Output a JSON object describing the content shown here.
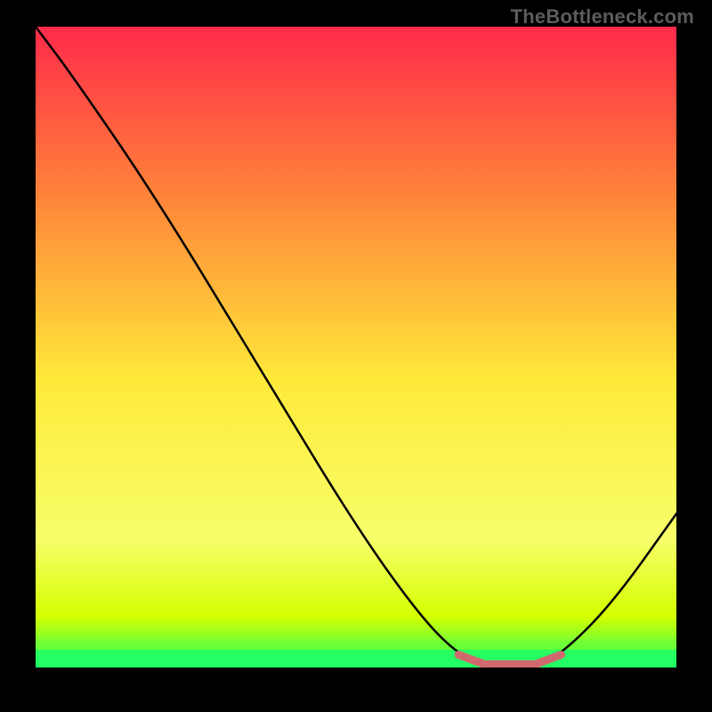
{
  "watermark": "TheBottleneck.com",
  "colors": {
    "background": "#000000",
    "gradient_top": "#ff2a4a",
    "gradient_mid_upper": "#ff7f3a",
    "gradient_mid": "#ffe93a",
    "gradient_mid_lower": "#f7ff6a",
    "gradient_band": "#d4ff00",
    "gradient_bottom": "#22ff66",
    "curve": "#000000",
    "optimal_marker": "#d0696d",
    "watermark": "#5c5c5c"
  },
  "chart_data": {
    "type": "line",
    "title": "",
    "xlabel": "",
    "ylabel": "",
    "xlim": [
      0,
      1
    ],
    "ylim": [
      0,
      1
    ],
    "series": [
      {
        "name": "bottleneck_curve",
        "points": [
          {
            "x": 0.0,
            "y": 1.0
          },
          {
            "x": 0.06,
            "y": 0.92
          },
          {
            "x": 0.19,
            "y": 0.73
          },
          {
            "x": 0.36,
            "y": 0.45
          },
          {
            "x": 0.5,
            "y": 0.22
          },
          {
            "x": 0.6,
            "y": 0.08
          },
          {
            "x": 0.66,
            "y": 0.02
          },
          {
            "x": 0.7,
            "y": 0.005
          },
          {
            "x": 0.78,
            "y": 0.005
          },
          {
            "x": 0.82,
            "y": 0.02
          },
          {
            "x": 0.9,
            "y": 0.1
          },
          {
            "x": 1.0,
            "y": 0.24
          }
        ]
      }
    ],
    "optimal_range": {
      "x_start": 0.66,
      "x_end": 0.82
    },
    "gradient_stops": [
      {
        "offset": 0.0,
        "color": "#ff2a4a"
      },
      {
        "offset": 0.25,
        "color": "#ff7f3a"
      },
      {
        "offset": 0.55,
        "color": "#ffe93a"
      },
      {
        "offset": 0.8,
        "color": "#f7ff6a"
      },
      {
        "offset": 0.92,
        "color": "#d4ff00"
      },
      {
        "offset": 1.0,
        "color": "#22ff66"
      }
    ]
  }
}
